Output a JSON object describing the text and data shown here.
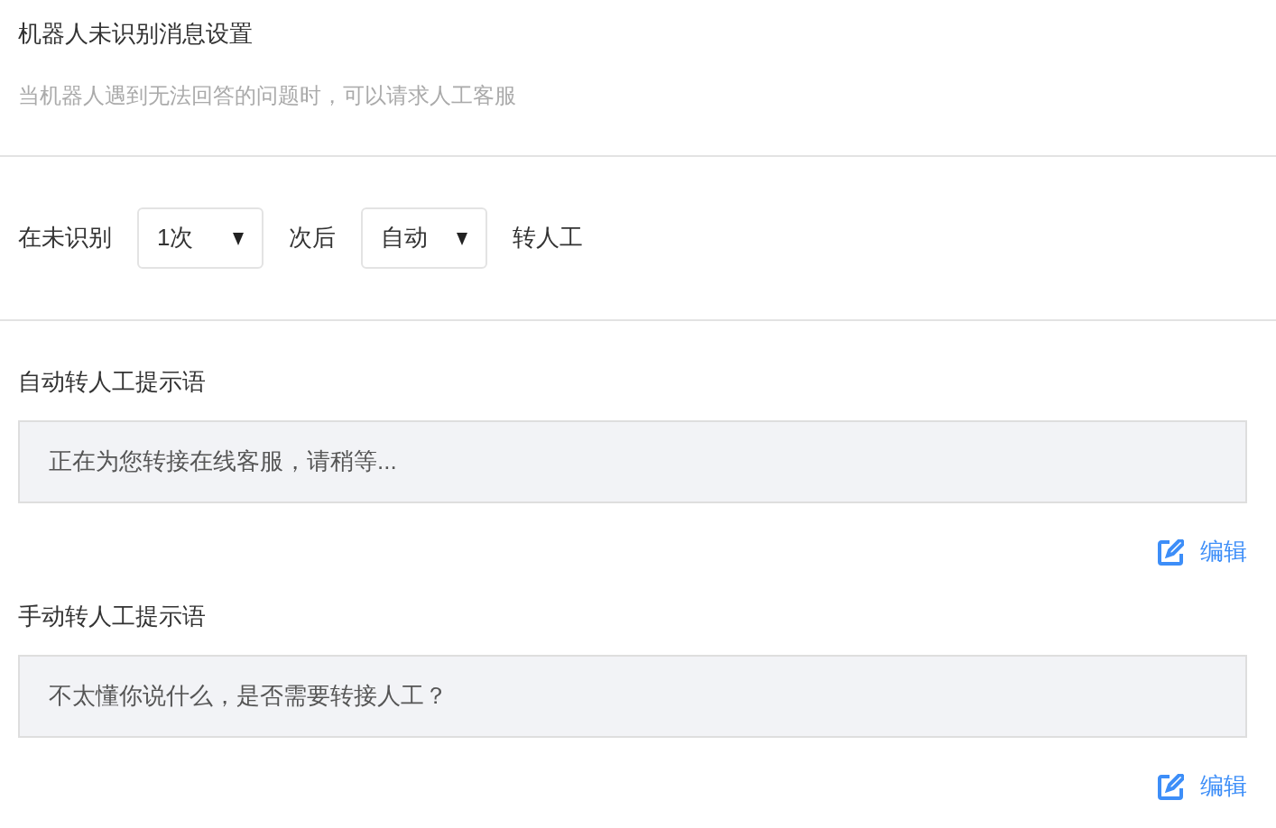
{
  "header": {
    "title": "机器人未识别消息设置",
    "description": "当机器人遇到无法回答的问题时，可以请求人工客服"
  },
  "rule": {
    "items": [
      {
        "kind": "text",
        "text": "在未识别"
      },
      {
        "kind": "select",
        "value": "1次"
      },
      {
        "kind": "text",
        "text": "次后"
      },
      {
        "kind": "select",
        "value": "自动"
      },
      {
        "kind": "text",
        "text": "转人工"
      }
    ]
  },
  "prompts": [
    {
      "label": "自动转人工提示语",
      "message": "正在为您转接在线客服，请稍等...",
      "edit": "编辑"
    },
    {
      "label": "手动转人工提示语",
      "message": "不太懂你说什么，是否需要转接人工？",
      "edit": "编辑"
    }
  ]
}
